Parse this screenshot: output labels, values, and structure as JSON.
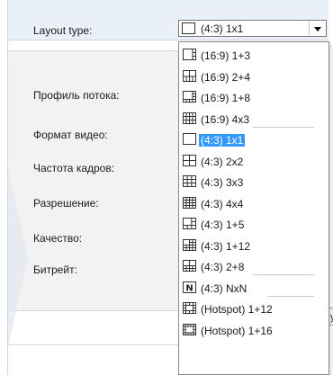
{
  "header": {
    "label": "Layout type:"
  },
  "select": {
    "value": "(4:3) 1x1",
    "icon": "layout-1x1-icon"
  },
  "fields": [
    {
      "label": "Профиль потока:"
    },
    {
      "label": "Формат видео:"
    },
    {
      "label": "Частота кадров:"
    },
    {
      "label": "Разрешение:"
    },
    {
      "label": "Качество:"
    },
    {
      "label": "Битрейт:"
    }
  ],
  "partial_button": {
    "label": "y"
  },
  "dropdown": {
    "options": [
      {
        "label": "(16:9) 1+3",
        "icon": "layout-1plus3-icon"
      },
      {
        "label": "(16:9) 2+4",
        "icon": "layout-2plus4-icon"
      },
      {
        "label": "(16:9) 1+8",
        "icon": "layout-1plus8-icon"
      },
      {
        "label": "(16:9) 4x3",
        "icon": "layout-4x3-icon"
      },
      {
        "label": "(4:3) 1x1",
        "icon": "layout-1x1-icon",
        "selected": true
      },
      {
        "label": "(4:3) 2x2",
        "icon": "layout-2x2-icon"
      },
      {
        "label": "(4:3) 3x3",
        "icon": "layout-3x3-icon"
      },
      {
        "label": "(4:3) 4x4",
        "icon": "layout-4x4-icon"
      },
      {
        "label": "(4:3) 1+5",
        "icon": "layout-1plus5-icon"
      },
      {
        "label": "(4:3) 1+12",
        "icon": "layout-1plus12-icon"
      },
      {
        "label": "(4:3) 2+8",
        "icon": "layout-2plus8-icon"
      },
      {
        "label": "(4:3) NxN",
        "icon": "layout-nxn-icon",
        "icon_text": "N"
      },
      {
        "label": "(Hotspot) 1+12",
        "icon": "layout-hotspot-1plus12-icon"
      },
      {
        "label": "(Hotspot) 1+16",
        "icon": "layout-hotspot-1plus16-icon"
      }
    ]
  },
  "colors": {
    "highlight": "#3399ff",
    "header_bg": "#e9f0f7"
  }
}
